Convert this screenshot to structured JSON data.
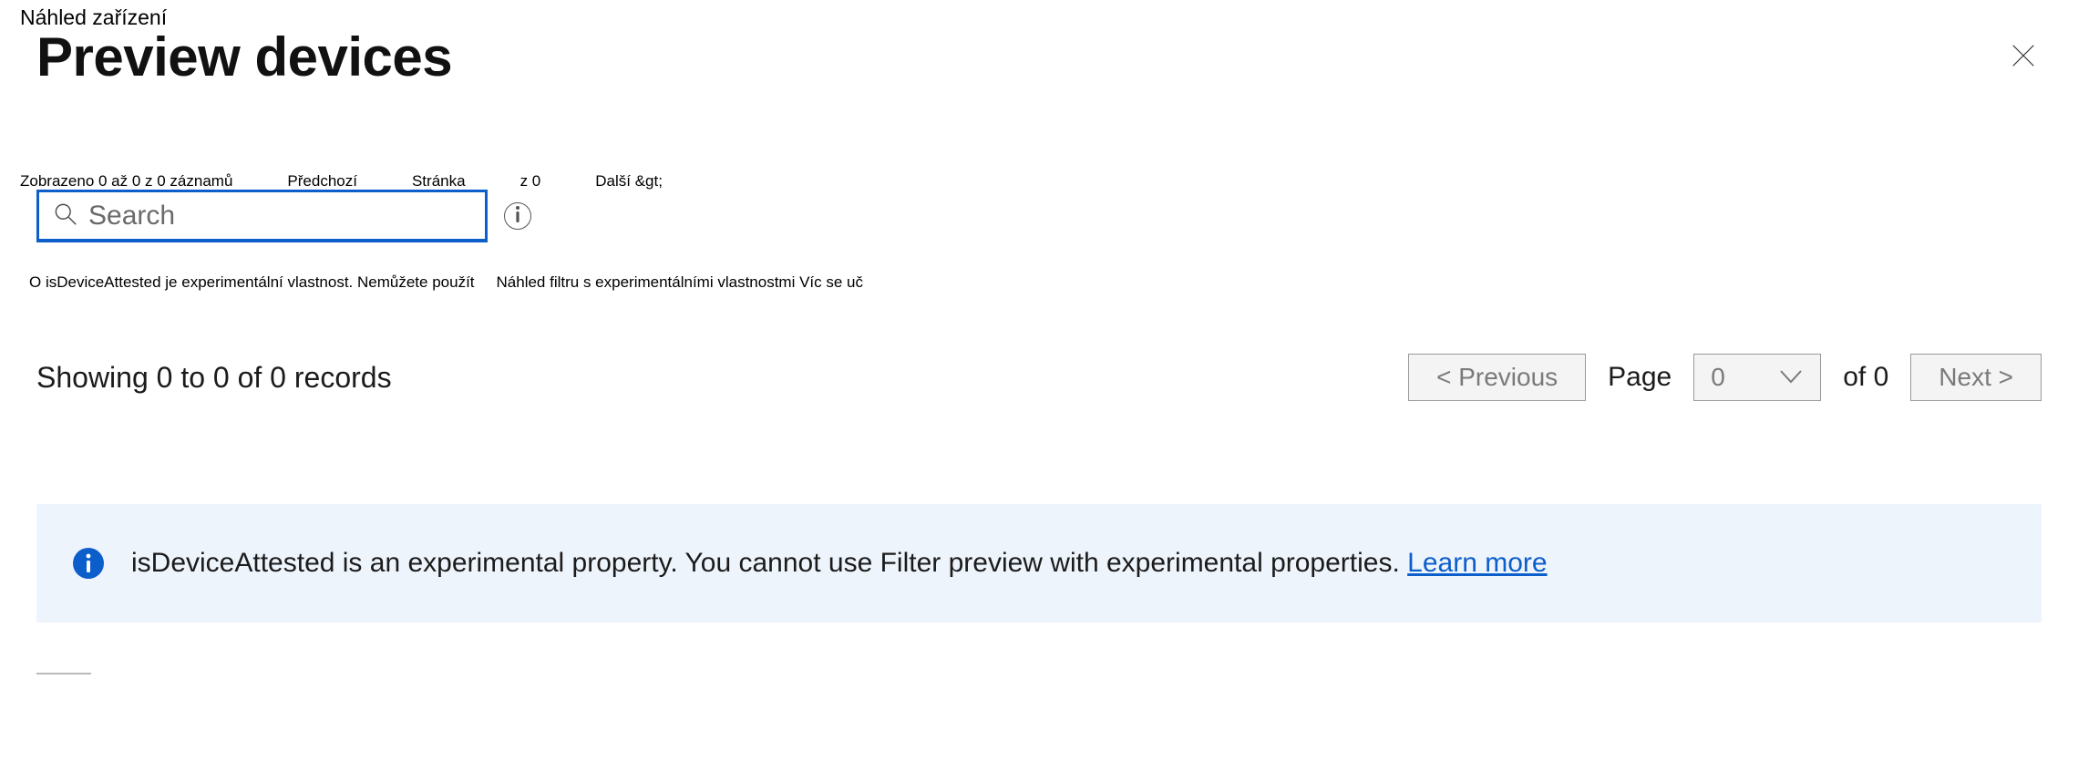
{
  "overlay": {
    "title": "Náhled zařízení",
    "counts": "Zobrazeno 0 až 0 z 0 záznamů",
    "prev": "Předchozí",
    "page": "Stránka",
    "of": "z 0",
    "next": "Další &gt;",
    "warn1": "O isDeviceAttested je experimentální vlastnost. Nemůžete použít",
    "warn2": "Náhled filtru s experimentálními vlastnostmi Víc se uč"
  },
  "header": {
    "title": "Preview devices"
  },
  "search": {
    "placeholder": "Search"
  },
  "results": {
    "text": "Showing 0 to 0 of 0 records"
  },
  "pagination": {
    "prev": "<  Previous",
    "page": "Page",
    "page_value": "0",
    "of": "of 0",
    "next": "Next  >"
  },
  "banner": {
    "text": "isDeviceAttested is an experimental property. You cannot use Filter preview with experimental properties. ",
    "learn_more": "Learn more"
  }
}
